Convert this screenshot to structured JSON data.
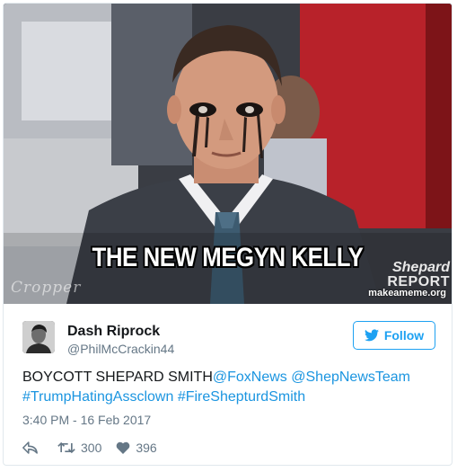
{
  "media": {
    "meme_caption": "THE NEW MEGYN KELLY",
    "watermark_left": "Cropper",
    "show_logo_line1": "Shepard",
    "show_logo_line2": "REPORT",
    "watermark_right": "makeameme.org"
  },
  "tweet": {
    "author_name": "Dash Riprock",
    "author_handle": "@PhilMcCrackin44",
    "follow_label": "Follow",
    "text_plain": "BOYCOTT SHEPARD SMITH",
    "mention_1": "@FoxNews",
    "mention_2": "@ShepNewsTeam",
    "hashtag_1": "#TrumpHatingAssclown",
    "hashtag_2": "#FireShepturdSmith",
    "timestamp": "3:40 PM - 16 Feb 2017",
    "retweet_count": "300",
    "like_count": "396"
  },
  "colors": {
    "link": "#1b95e0",
    "follow_accent": "#1da1f2",
    "muted": "#657786"
  },
  "icons": [
    "twitter-bird-icon",
    "reply-icon",
    "retweet-icon",
    "heart-icon"
  ]
}
